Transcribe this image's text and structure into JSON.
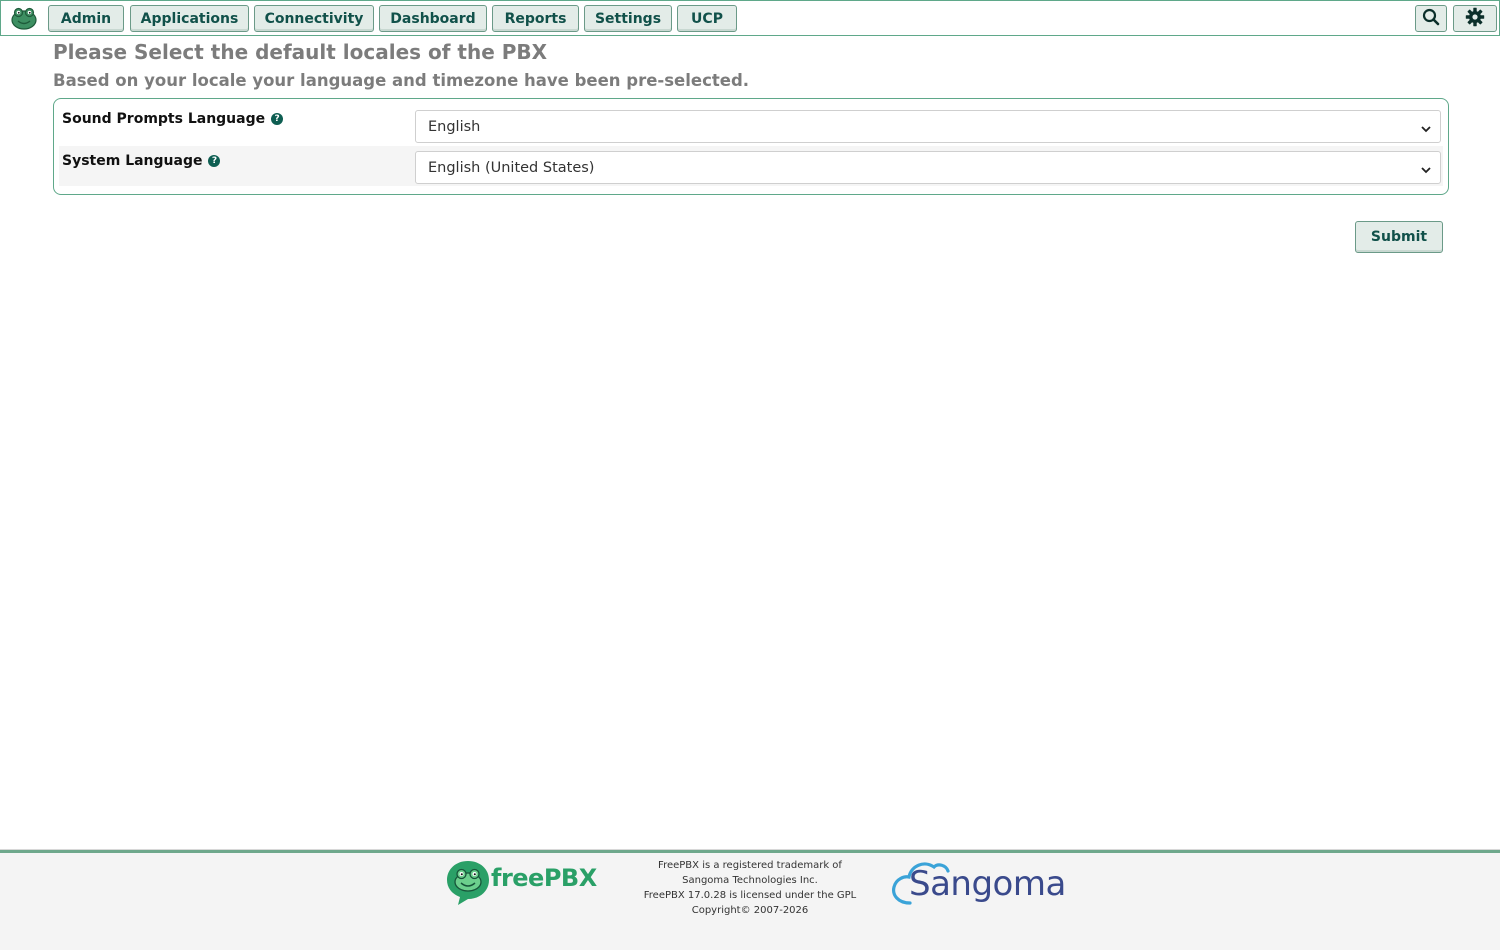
{
  "nav": {
    "items": [
      {
        "label": "Admin"
      },
      {
        "label": "Applications"
      },
      {
        "label": "Connectivity"
      },
      {
        "label": "Dashboard"
      },
      {
        "label": "Reports"
      },
      {
        "label": "Settings"
      },
      {
        "label": "UCP"
      }
    ],
    "search_icon": "search-icon",
    "settings_icon": "gear-icon"
  },
  "page": {
    "title": "Please Select the default locales of the PBX",
    "subtitle": "Based on your locale your language and timezone have been pre-selected."
  },
  "form": {
    "sound_prompts": {
      "label": "Sound Prompts Language",
      "value": "English"
    },
    "system_language": {
      "label": "System Language",
      "value": "English (United States)"
    },
    "help_glyph": "?",
    "submit_label": "Submit"
  },
  "footer": {
    "freepbx_logo_text": "freePBX",
    "legal_lines": [
      "FreePBX is a registered trademark of",
      "Sangoma Technologies Inc.",
      "FreePBX 17.0.28 is licensed under the GPL",
      "Copyright© 2007-2026"
    ],
    "sangoma_logo_text": "Sangoma"
  },
  "colors": {
    "accent": "#11514a",
    "border": "#5fa88a",
    "button_bg": "#e3ece8",
    "brand_green": "#2aa067",
    "sangoma_blue": "#3a4a8c"
  }
}
